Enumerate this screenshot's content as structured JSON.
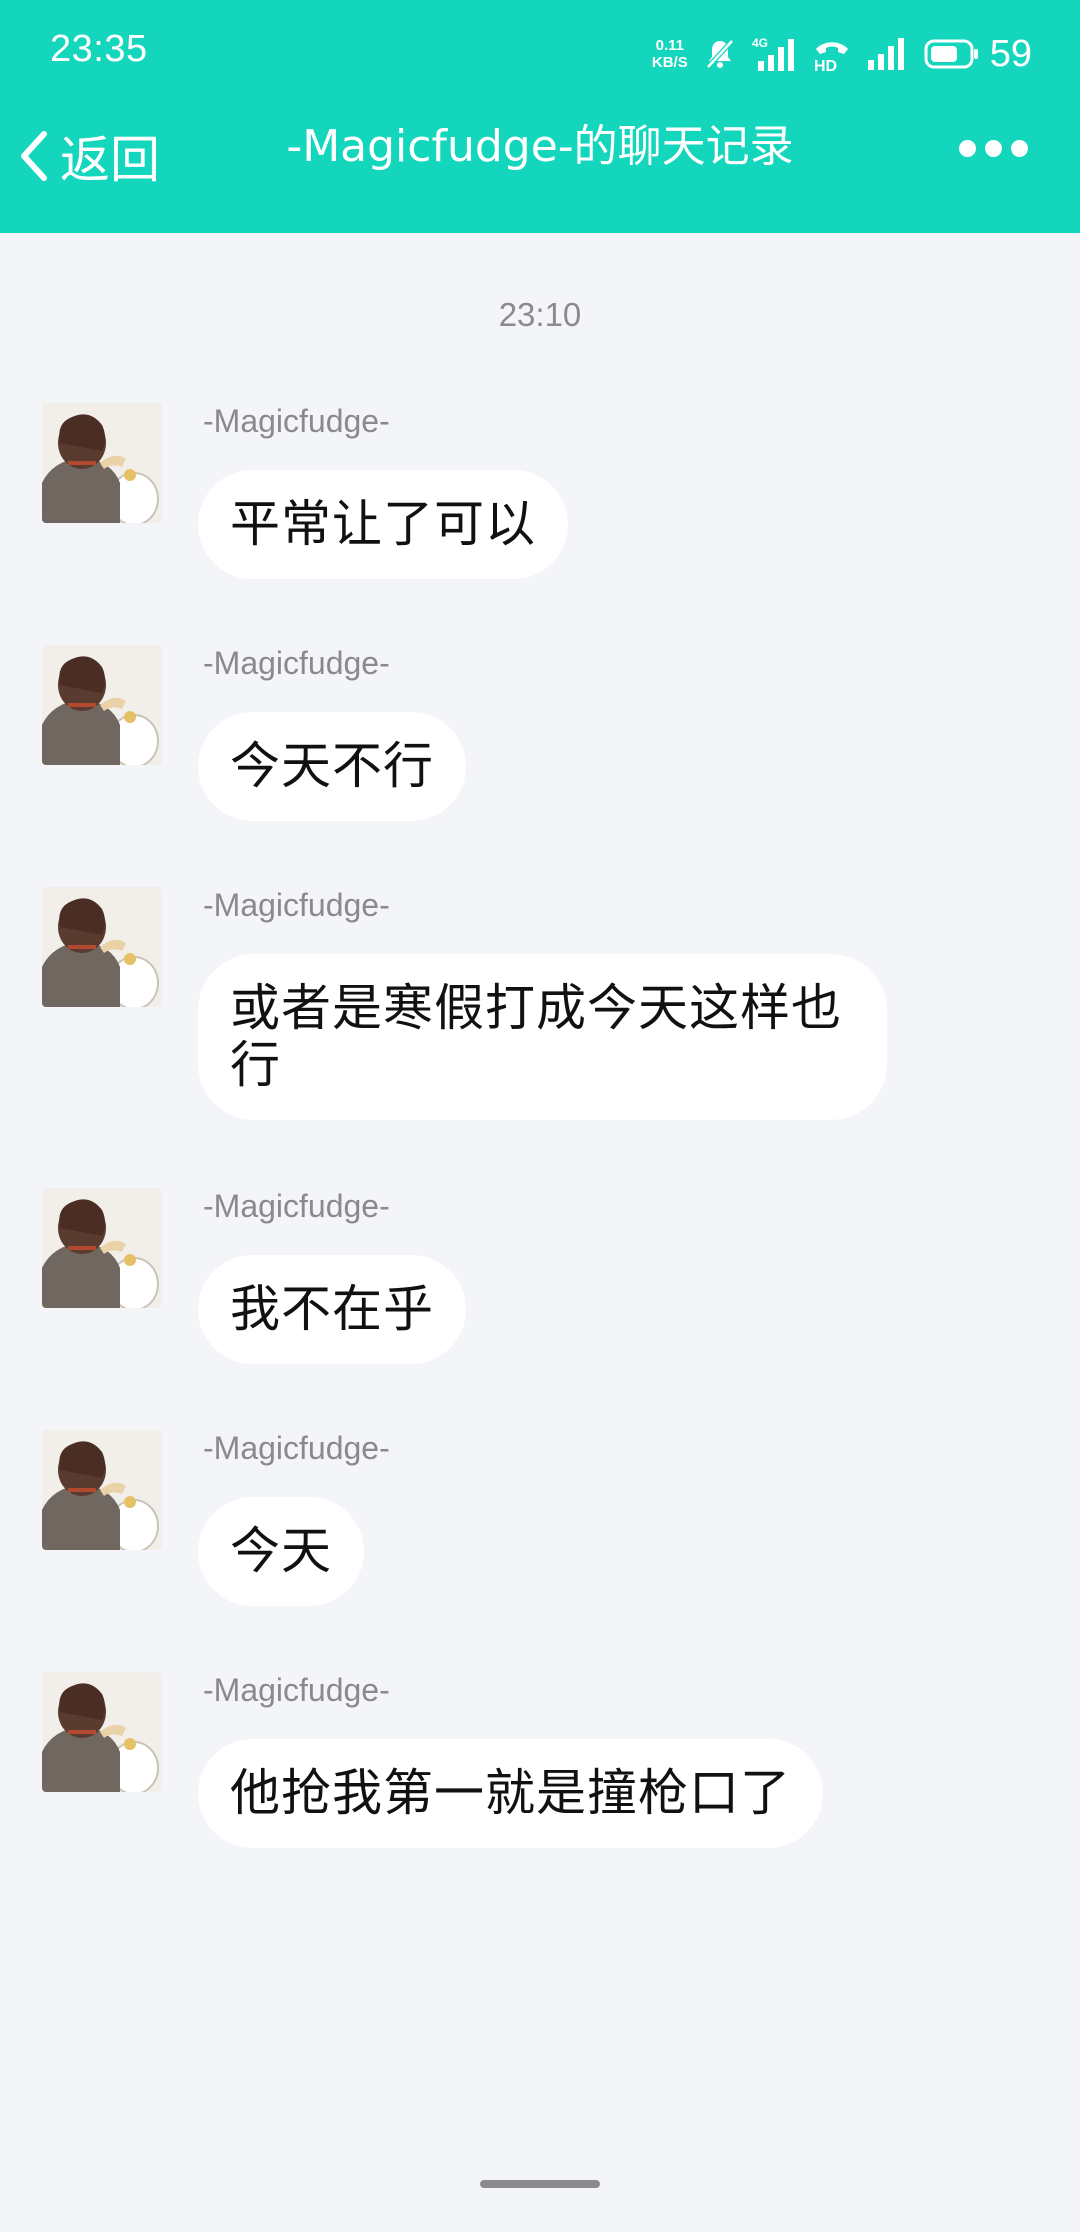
{
  "status_bar": {
    "time": "23:35",
    "net_speed_value": "0.11",
    "net_speed_unit": "KB/S",
    "network_type": "4G",
    "hd_label": "HD",
    "battery_level": "59"
  },
  "header": {
    "back_label": "返回",
    "title": "-Magicfudge-的聊天记录"
  },
  "timestamp": "23:10",
  "messages": [
    {
      "sender": "-Magicfudge-",
      "text": "平常让了可以"
    },
    {
      "sender": "-Magicfudge-",
      "text": "今天不行"
    },
    {
      "sender": "-Magicfudge-",
      "text": "或者是寒假打成今天这样也行"
    },
    {
      "sender": "-Magicfudge-",
      "text": "我不在乎"
    },
    {
      "sender": "-Magicfudge-",
      "text": "今天"
    },
    {
      "sender": "-Magicfudge-",
      "text": "他抢我第一就是撞枪口了"
    }
  ],
  "colors": {
    "header_bg": "#13d6bd",
    "page_bg": "#f4f5f9",
    "bubble_bg": "#ffffff"
  }
}
